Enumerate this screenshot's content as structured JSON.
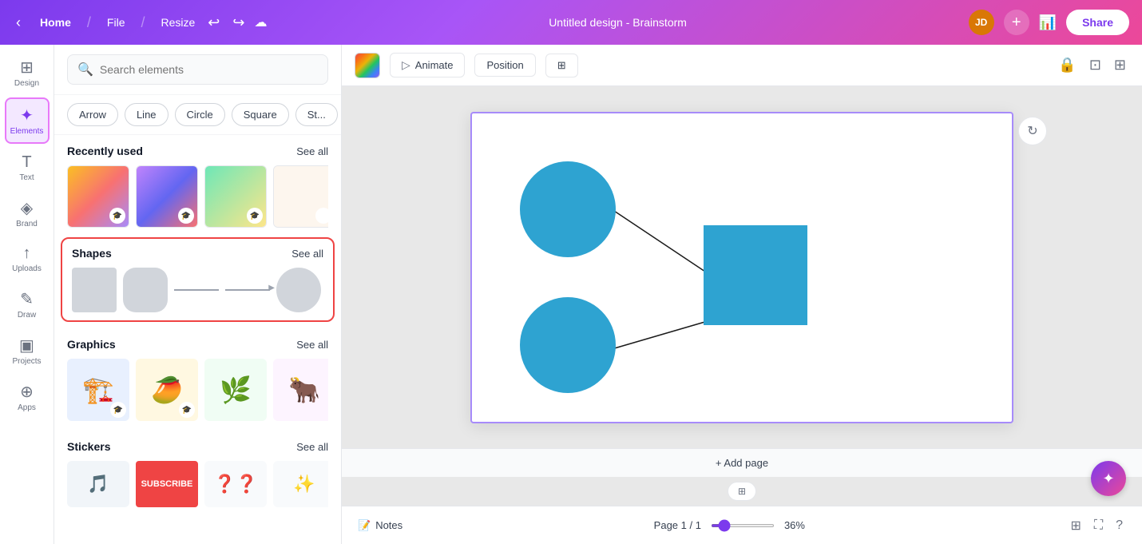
{
  "topbar": {
    "home_label": "Home",
    "file_label": "File",
    "resize_label": "Resize",
    "title": "Untitled design - Brainstorm",
    "share_label": "Share",
    "avatar_initials": "JD"
  },
  "sidebar": {
    "items": [
      {
        "id": "design",
        "label": "Design",
        "icon": "⊞"
      },
      {
        "id": "elements",
        "label": "Elements",
        "icon": "✦",
        "active": true
      },
      {
        "id": "text",
        "label": "Text",
        "icon": "T"
      },
      {
        "id": "brand",
        "label": "Brand",
        "icon": "◈"
      },
      {
        "id": "uploads",
        "label": "Uploads",
        "icon": "↑"
      },
      {
        "id": "draw",
        "label": "Draw",
        "icon": "✎"
      },
      {
        "id": "projects",
        "label": "Projects",
        "icon": "▣"
      },
      {
        "id": "apps",
        "label": "Apps",
        "icon": "⊕"
      }
    ]
  },
  "elements_panel": {
    "search_placeholder": "Search elements",
    "filter_tags": [
      "Arrow",
      "Line",
      "Circle",
      "Square",
      "St..."
    ],
    "recently_used_title": "Recently used",
    "recently_used_see_all": "See all",
    "shapes_title": "Shapes",
    "shapes_see_all": "See all",
    "graphics_title": "Graphics",
    "graphics_see_all": "See all",
    "stickers_title": "Stickers",
    "stickers_see_all": "See all"
  },
  "canvas_toolbar": {
    "animate_label": "Animate",
    "position_label": "Position",
    "filter_icon": "⊞"
  },
  "canvas": {
    "add_page_label": "+ Add page",
    "page_info": "Page 1 / 1",
    "zoom_level": "36%"
  },
  "bottom_bar": {
    "notes_label": "Notes",
    "page_info": "Page 1 / 1",
    "zoom_level": "36%"
  }
}
